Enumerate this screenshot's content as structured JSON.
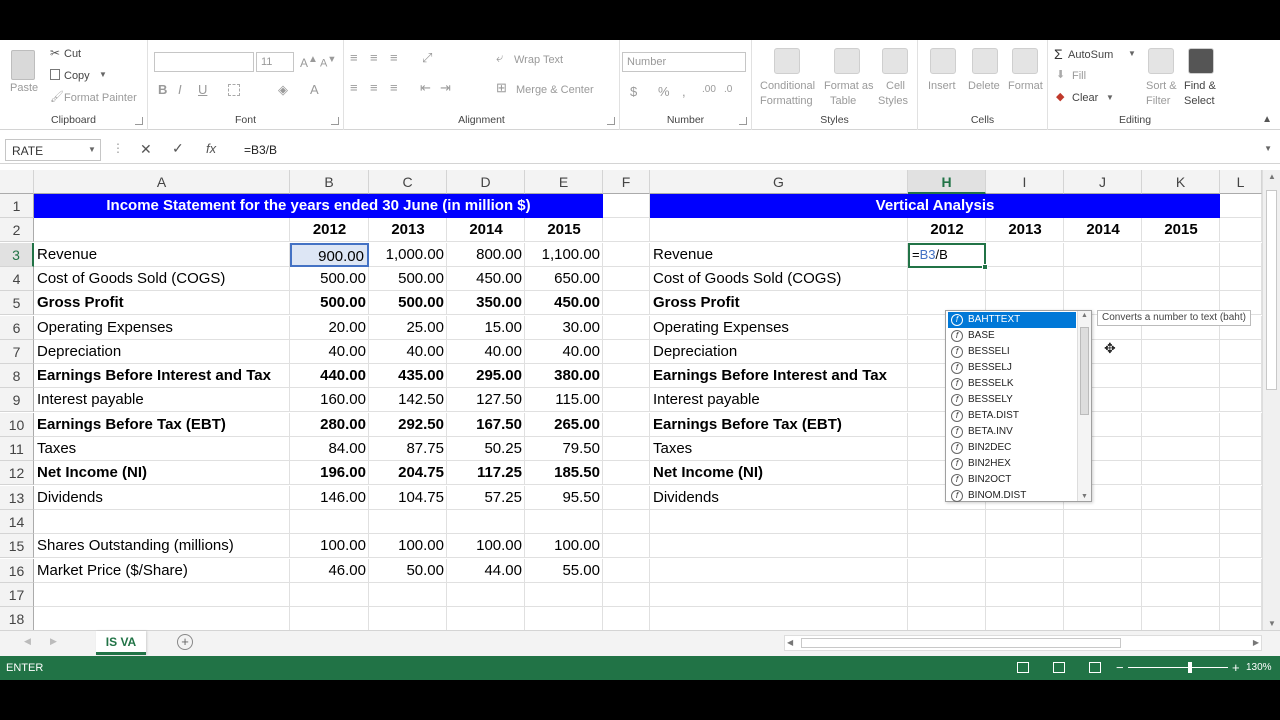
{
  "ribbon": {
    "clipboard": {
      "label": "Clipboard",
      "paste": "Paste",
      "cut": "Cut",
      "copy": "Copy",
      "format_painter": "Format Painter"
    },
    "font": {
      "label": "Font",
      "size": "11"
    },
    "alignment": {
      "label": "Alignment",
      "wrap_text": "Wrap Text",
      "merge_center": "Merge & Center"
    },
    "number": {
      "label": "Number",
      "format": "Number"
    },
    "styles": {
      "label": "Styles",
      "conditional_1": "Conditional",
      "conditional_2": "Formatting",
      "format_table_1": "Format as",
      "format_table_2": "Table",
      "cell_styles_1": "Cell",
      "cell_styles_2": "Styles"
    },
    "cells": {
      "label": "Cells",
      "insert": "Insert",
      "delete": "Delete",
      "format": "Format"
    },
    "editing": {
      "label": "Editing",
      "autosum": "AutoSum",
      "fill": "Fill",
      "clear": "Clear",
      "sort_1": "Sort &",
      "sort_2": "Filter",
      "find_1": "Find &",
      "find_2": "Select"
    }
  },
  "formula_bar": {
    "name_box": "RATE",
    "formula": "=B3/B"
  },
  "columns": [
    "A",
    "B",
    "C",
    "D",
    "E",
    "F",
    "G",
    "H",
    "I",
    "J",
    "K",
    "L"
  ],
  "rows": [
    "1",
    "2",
    "3",
    "4",
    "5",
    "6",
    "7",
    "8",
    "9",
    "10",
    "11",
    "12",
    "13",
    "14",
    "15",
    "16",
    "17",
    "18"
  ],
  "left_table": {
    "title": "Income Statement for the years ended 30 June (in million $)",
    "years": [
      "2012",
      "2013",
      "2014",
      "2015"
    ],
    "rows": [
      {
        "label": "Revenue",
        "values": [
          "900.00",
          "1,000.00",
          "800.00",
          "1,100.00"
        ],
        "bold": false
      },
      {
        "label": "Cost of Goods Sold (COGS)",
        "values": [
          "500.00",
          "500.00",
          "450.00",
          "650.00"
        ],
        "bold": false
      },
      {
        "label": "Gross Profit",
        "values": [
          "500.00",
          "500.00",
          "350.00",
          "450.00"
        ],
        "bold": true
      },
      {
        "label": "Operating Expenses",
        "values": [
          "20.00",
          "25.00",
          "15.00",
          "30.00"
        ],
        "bold": false
      },
      {
        "label": "Depreciation",
        "values": [
          "40.00",
          "40.00",
          "40.00",
          "40.00"
        ],
        "bold": false
      },
      {
        "label": "Earnings Before Interest and Tax",
        "values": [
          "440.00",
          "435.00",
          "295.00",
          "380.00"
        ],
        "bold": true
      },
      {
        "label": "Interest payable",
        "values": [
          "160.00",
          "142.50",
          "127.50",
          "115.00"
        ],
        "bold": false
      },
      {
        "label": "Earnings Before Tax (EBT)",
        "values": [
          "280.00",
          "292.50",
          "167.50",
          "265.00"
        ],
        "bold": true
      },
      {
        "label": "Taxes",
        "values": [
          "84.00",
          "87.75",
          "50.25",
          "79.50"
        ],
        "bold": false
      },
      {
        "label": "Net Income (NI)",
        "values": [
          "196.00",
          "204.75",
          "117.25",
          "185.50"
        ],
        "bold": true
      },
      {
        "label": "Dividends",
        "values": [
          "146.00",
          "104.75",
          "57.25",
          "95.50"
        ],
        "bold": false
      }
    ],
    "extra_rows": [
      {
        "label": "Shares Outstanding (millions)",
        "values": [
          "100.00",
          "100.00",
          "100.00",
          "100.00"
        ]
      },
      {
        "label": "Market Price ($/Share)",
        "values": [
          "46.00",
          "50.00",
          "44.00",
          "55.00"
        ]
      }
    ]
  },
  "right_table": {
    "title": "Vertical Analysis",
    "years": [
      "2012",
      "2013",
      "2014",
      "2015"
    ],
    "labels": [
      "Revenue",
      "Cost of Goods Sold (COGS)",
      "Gross Profit",
      "Operating Expenses",
      "Depreciation",
      "Earnings Before Interest and Tax",
      "Interest payable",
      "Earnings Before Tax (EBT)",
      "Taxes",
      "Net Income (NI)",
      "Dividends"
    ],
    "bold": [
      false,
      false,
      true,
      false,
      false,
      true,
      false,
      true,
      false,
      true,
      false
    ],
    "editing_cell": {
      "prefix": "=",
      "ref": "B3",
      "suffix": "/B"
    }
  },
  "autocomplete": {
    "items": [
      "BAHTTEXT",
      "BASE",
      "BESSELI",
      "BESSELJ",
      "BESSELK",
      "BESSELY",
      "BETA.DIST",
      "BETA.INV",
      "BIN2DEC",
      "BIN2HEX",
      "BIN2OCT",
      "BINOM.DIST"
    ],
    "selected": 0,
    "tooltip": "Converts a number to text (baht)"
  },
  "sheet_tab": "IS VA",
  "status": {
    "mode": "ENTER",
    "zoom": "130%"
  },
  "colors": {
    "excel_green": "#217346",
    "banner_blue": "#0000ff",
    "ref_blue": "#4472c4"
  }
}
